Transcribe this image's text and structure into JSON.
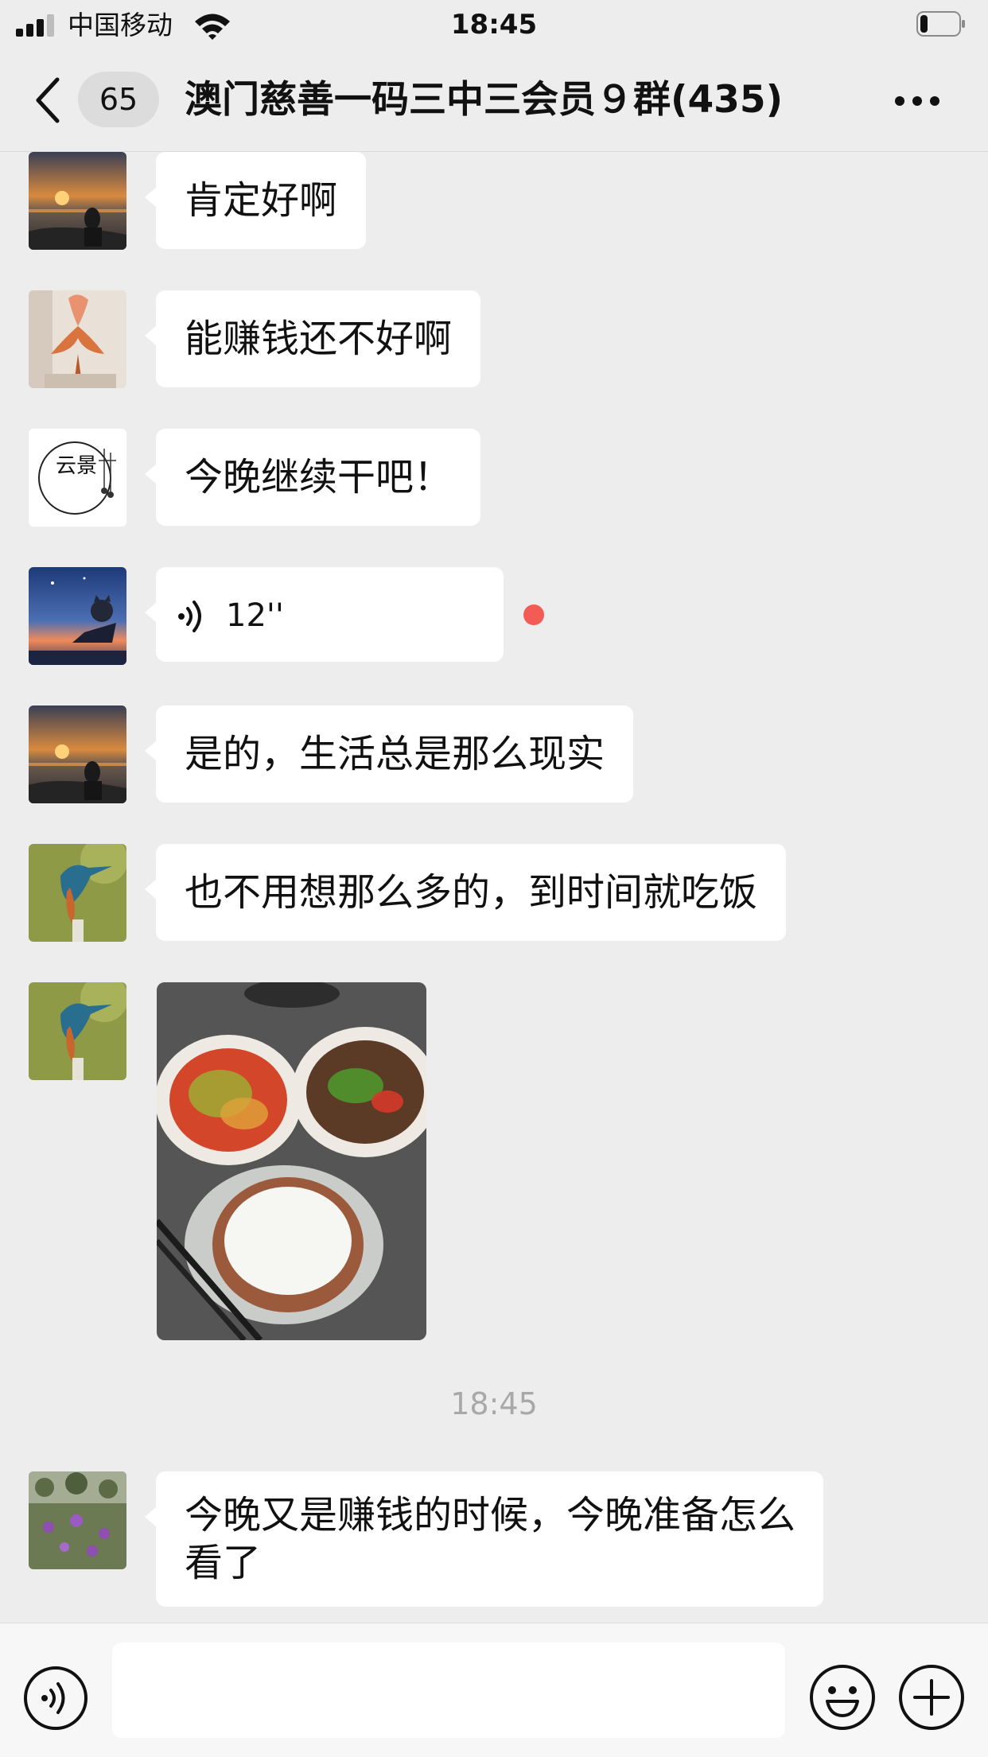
{
  "status_bar": {
    "carrier": "中国移动",
    "time": "18:45",
    "battery_level": 0.2
  },
  "nav": {
    "back_icon": "chevron-left-icon",
    "unread_count": "65",
    "title": "澳门慈善一码三中三会员９群(435)",
    "more_icon": "more-dots-icon"
  },
  "messages": [
    {
      "type": "text",
      "avatar": "sunset-woman-avatar",
      "text": "肯定好啊"
    },
    {
      "type": "text",
      "avatar": "flamingo-avatar",
      "text": "能赚钱还不好啊"
    },
    {
      "type": "text",
      "avatar": "yunjing-avatar",
      "avatar_text": "云景",
      "text": "今晚继续干吧！"
    },
    {
      "type": "voice",
      "avatar": "cat-sunset-avatar",
      "duration": "12''",
      "unread": true
    },
    {
      "type": "text",
      "avatar": "sunset-woman-avatar",
      "text": "是的，生活总是那么现实"
    },
    {
      "type": "text",
      "avatar": "kingfisher-avatar",
      "text": "也不用想那么多的，到时间就吃饭"
    },
    {
      "type": "image",
      "avatar": "kingfisher-avatar",
      "image": "food-photo"
    },
    {
      "type": "time",
      "text": "18:45"
    },
    {
      "type": "text",
      "avatar": "flowers-avatar",
      "text": "今晚又是赚钱的时候，今晚准备怎么看了"
    }
  ],
  "input_bar": {
    "voice_icon": "voice-mode-icon",
    "input_value": "",
    "emoji_icon": "emoji-icon",
    "plus_icon": "plus-icon"
  }
}
